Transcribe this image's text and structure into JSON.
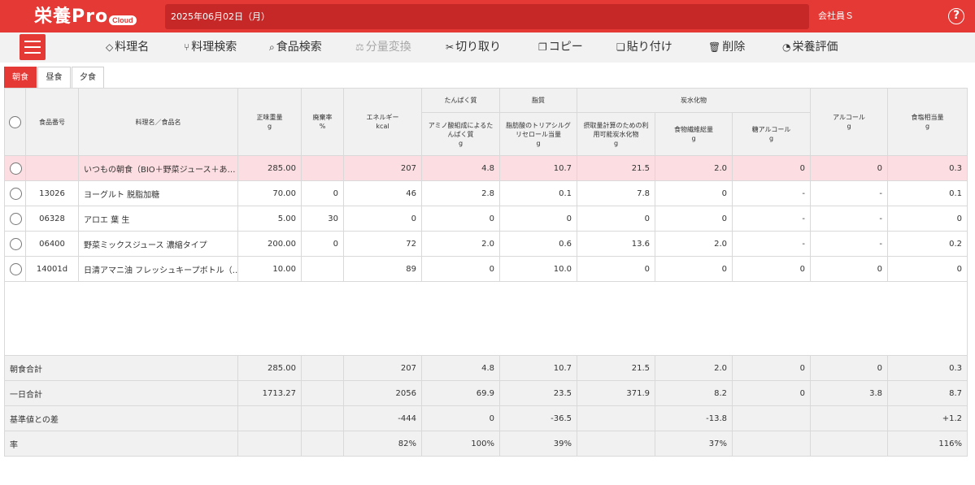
{
  "header": {
    "logo_text": "栄養Pro",
    "logo_badge": "Cloud",
    "date": "2025年06月02日（月）",
    "user": "会社員Ｓ",
    "help_glyph": "?"
  },
  "toolbar": {
    "items": [
      {
        "label": "料理名",
        "icon": "tag-icon",
        "glyph": "◇"
      },
      {
        "label": "料理検索",
        "icon": "fork-knife-icon",
        "glyph": "⑂"
      },
      {
        "label": "食品検索",
        "icon": "search-icon",
        "glyph": "⌕"
      },
      {
        "label": "分量変換",
        "icon": "scale-icon",
        "glyph": "⚖"
      },
      {
        "label": "切り取り",
        "icon": "scissors-icon",
        "glyph": "✂"
      },
      {
        "label": "コピー",
        "icon": "copy-icon",
        "glyph": "❐"
      },
      {
        "label": "貼り付け",
        "icon": "paste-icon",
        "glyph": "❏"
      },
      {
        "label": "削除",
        "icon": "trash-icon",
        "glyph": "🗑"
      },
      {
        "label": "栄養評価",
        "icon": "pie-chart-icon",
        "glyph": "◔"
      }
    ]
  },
  "tabs": [
    {
      "label": "朝食",
      "active": true
    },
    {
      "label": "昼食",
      "active": false
    },
    {
      "label": "夕食",
      "active": false
    }
  ],
  "table": {
    "headers": {
      "food_no": "食品番号",
      "name": "料理名／食品名",
      "weight": "正味重量",
      "weight_unit": "g",
      "waste": "廃棄率",
      "waste_unit": "%",
      "energy": "エネルギー",
      "energy_unit": "kcal",
      "protein_group": "たんぱく質",
      "protein": "アミノ酸組成によるたんぱく質",
      "protein_unit": "g",
      "fat_group": "脂質",
      "fat": "脂肪酸のトリアシルグリセロール当量",
      "fat_unit": "g",
      "carb_group": "炭水化物",
      "carb": "摂取量計算のための利用可能炭水化物",
      "carb_unit": "g",
      "fiber": "食物繊維総量",
      "fiber_unit": "g",
      "sugar_alcohol": "糖アルコール",
      "sugar_alcohol_unit": "g",
      "alcohol": "アルコール",
      "alcohol_unit": "g",
      "salt": "食塩相当量",
      "salt_unit": "g"
    },
    "rows": [
      {
        "no": "",
        "name": "いつもの朝食（BIO＋野菜ジュース＋あ…",
        "weight": "285.00",
        "waste": "",
        "energy": "207",
        "protein": "4.8",
        "fat": "10.7",
        "carb": "21.5",
        "fiber": "2.0",
        "sugar_alcohol": "0",
        "alcohol": "0",
        "salt": "0.3",
        "highlight": true
      },
      {
        "no": "13026",
        "name": "ヨーグルト 脱脂加糖",
        "weight": "70.00",
        "waste": "0",
        "energy": "46",
        "protein": "2.8",
        "fat": "0.1",
        "carb": "7.8",
        "fiber": "0",
        "sugar_alcohol": "-",
        "alcohol": "-",
        "salt": "0.1"
      },
      {
        "no": "06328",
        "name": "アロエ 葉 生",
        "weight": "5.00",
        "waste": "30",
        "energy": "0",
        "protein": "0",
        "fat": "0",
        "carb": "0",
        "fiber": "0",
        "sugar_alcohol": "-",
        "alcohol": "-",
        "salt": "0"
      },
      {
        "no": "06400",
        "name": "野菜ミックスジュース 濃縮タイプ",
        "weight": "200.00",
        "waste": "0",
        "energy": "72",
        "protein": "2.0",
        "fat": "0.6",
        "carb": "13.6",
        "fiber": "2.0",
        "sugar_alcohol": "-",
        "alcohol": "-",
        "salt": "0.2"
      },
      {
        "no": "14001d",
        "name": "日清アマニ油 フレッシュキープボトル（…",
        "weight": "10.00",
        "waste": "",
        "energy": "89",
        "protein": "0",
        "fat": "10.0",
        "carb": "0",
        "fiber": "0",
        "sugar_alcohol": "0",
        "alcohol": "0",
        "salt": "0"
      }
    ],
    "summary": [
      {
        "label": "朝食合計",
        "weight": "285.00",
        "waste": "",
        "energy": "207",
        "protein": "4.8",
        "fat": "10.7",
        "carb": "21.5",
        "fiber": "2.0",
        "sugar_alcohol": "0",
        "alcohol": "0",
        "salt": "0.3"
      },
      {
        "label": "一日合計",
        "weight": "1713.27",
        "waste": "",
        "energy": "2056",
        "protein": "69.9",
        "fat": "23.5",
        "carb": "371.9",
        "fiber": "8.2",
        "sugar_alcohol": "0",
        "alcohol": "3.8",
        "salt": "8.7"
      },
      {
        "label": "基準値との差",
        "weight": "",
        "waste": "",
        "energy": "-444",
        "protein": "0",
        "fat": "-36.5",
        "carb": "",
        "fiber": "-13.8",
        "sugar_alcohol": "",
        "alcohol": "",
        "salt": "+1.2"
      },
      {
        "label": "率",
        "weight": "",
        "waste": "",
        "energy": "82%",
        "protein": "100%",
        "fat": "39%",
        "carb": "",
        "fiber": "37%",
        "sugar_alcohol": "",
        "alcohol": "",
        "salt": "116%"
      }
    ]
  },
  "colors": {
    "brand_red": "#e53935",
    "date_bar": "#c62828",
    "highlight_row": "#fcdde1",
    "header_bg": "#f1f1f1"
  }
}
